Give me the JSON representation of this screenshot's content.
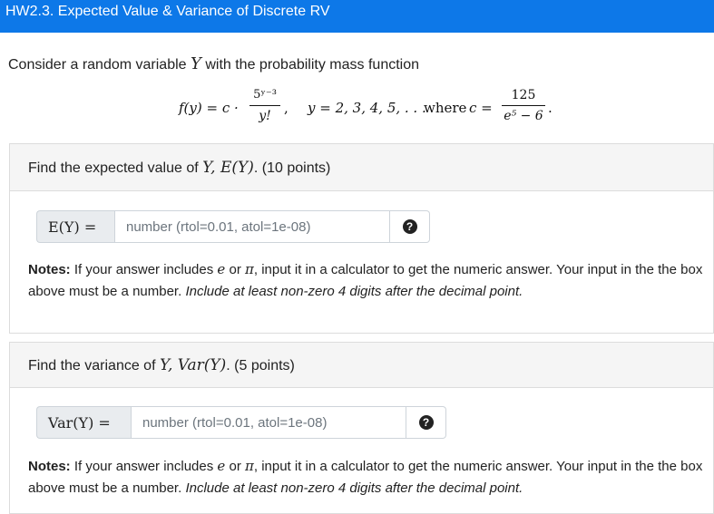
{
  "header": {
    "title": "HW2.3. Expected Value & Variance of Discrete RV"
  },
  "intro": {
    "text_before": "Consider a random variable ",
    "var": "Y",
    "text_after": " with the probability mass function"
  },
  "formula": {
    "lhs": "f(y) = c ·",
    "frac_num": "5ʸ⁻³",
    "frac_den": "y!",
    "comma": ",",
    "domain": "y = 2, 3, 4, 5, . . .",
    "where": "where",
    "c_eq": "c =",
    "c_num": "125",
    "c_den": "e⁵ − 6",
    "period": "."
  },
  "part1": {
    "prompt_before": "Find the expected value of ",
    "prompt_math": "Y, E(Y)",
    "prompt_after": ". (10 points)",
    "label": "E(Y) =",
    "placeholder": "number (rtol=0.01, atol=1e-08)",
    "value": ""
  },
  "part2": {
    "prompt_before": "Find the variance of ",
    "prompt_math": "Y, Var(Y)",
    "prompt_after": ". (5 points)",
    "label": "Var(Y) =",
    "placeholder": "number (rtol=0.01, atol=1e-08)",
    "value": ""
  },
  "notes1": {
    "bold": "Notes:",
    "text1": " If your answer includes ",
    "e": "e",
    "or": " or ",
    "pi": "π",
    "text2": ", input it in a calculator to get the numeric answer. Your input in the the box above must be a number. ",
    "italic": "Include at least non-zero 4 digits after the decimal point."
  },
  "notes2": {
    "bold": "Notes:",
    "text1": " If your answer includes ",
    "e": "e",
    "or": " or ",
    "pi": "π",
    "text2": ", input it in a calculator to get the numeric answer. Your input in the the box above must be a number. ",
    "italic": "Include at least non-zero 4 digits after the decimal point."
  },
  "icons": {
    "help": "question-circle-icon",
    "help_glyph": "?"
  },
  "colors": {
    "header_bg": "#0d78e8",
    "card_head_bg": "#f5f5f5"
  }
}
